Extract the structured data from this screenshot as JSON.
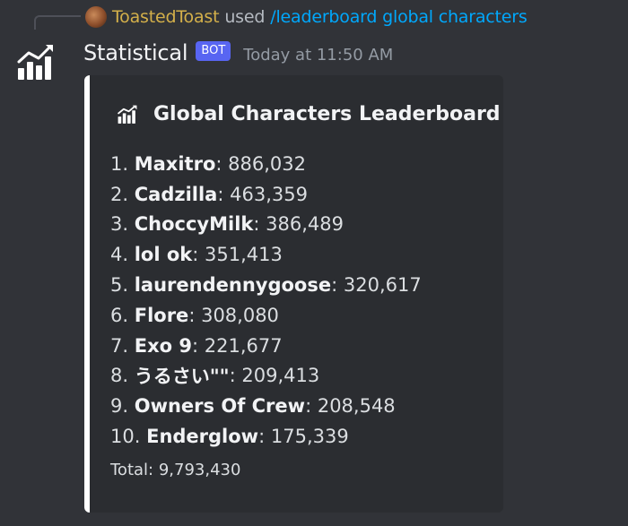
{
  "reply": {
    "user": "ToastedToast",
    "used": "used",
    "command": "/leaderboard global characters"
  },
  "message": {
    "username": "Statistical",
    "bot_tag": "BOT",
    "timestamp": "Today at 11:50 AM"
  },
  "embed": {
    "title": "Global Characters Leaderboard",
    "entries": [
      {
        "rank": "1.",
        "name": "Maxitro",
        "value": "886,032"
      },
      {
        "rank": "2.",
        "name": "Cadzilla",
        "value": "463,359"
      },
      {
        "rank": "3.",
        "name": "ChoccyMilk",
        "value": "386,489"
      },
      {
        "rank": "4.",
        "name": "lol ok",
        "value": "351,413"
      },
      {
        "rank": "5.",
        "name": "laurendennygoose",
        "value": "320,617"
      },
      {
        "rank": "6.",
        "name": "Flore",
        "value": "308,080"
      },
      {
        "rank": "7.",
        "name": "Exo 9",
        "value": "221,677"
      },
      {
        "rank": "8.",
        "name": "うるさい\"\"",
        "value": "209,413"
      },
      {
        "rank": "9.",
        "name": "Owners Of Crew",
        "value": "208,548"
      },
      {
        "rank": "10.",
        "name": "Enderglow",
        "value": "175,339"
      }
    ],
    "total": "Total: 9,793,430"
  },
  "icons": {
    "bot_avatar": "bar-chart-trend-icon",
    "title_icon": "bar-chart-trend-icon",
    "reply_avatar": "user-avatar"
  },
  "colors": {
    "background": "#313338",
    "embed_background": "#2b2d31",
    "embed_accent": "#ffffff",
    "reply_username": "#d4b04a",
    "command_link": "#00a8fc",
    "bot_tag": "#5865f2"
  }
}
